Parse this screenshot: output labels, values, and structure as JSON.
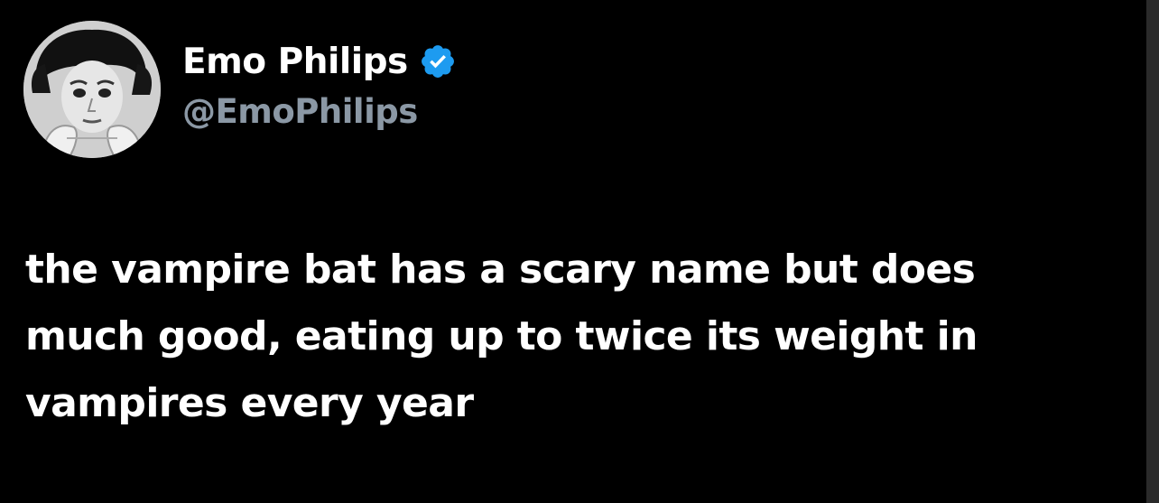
{
  "author": {
    "display_name": "Emo Philips",
    "handle": "@EmoPhilips",
    "verified": true,
    "verified_color": "#1d9bf0"
  },
  "tweet": {
    "text_lines": [
      "the vampire bat has a scary name but does",
      "much good, eating up to twice its weight in",
      "vampires every year"
    ]
  },
  "colors": {
    "background": "#000000",
    "text": "#ffffff",
    "handle": "#8b98a5"
  },
  "icons": {
    "verified": "verified-badge-icon",
    "avatar": "profile-photo"
  }
}
